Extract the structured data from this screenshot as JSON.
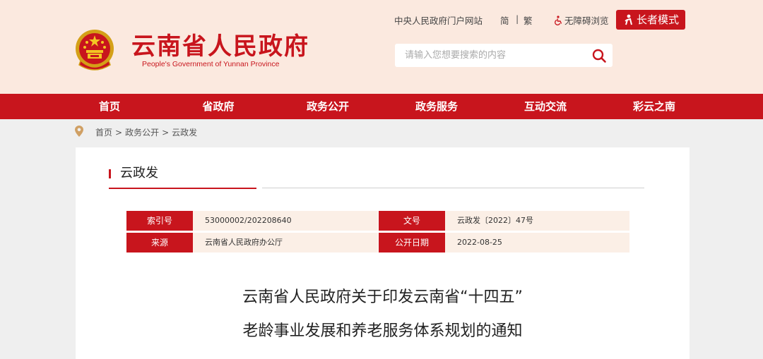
{
  "header": {
    "site_title": "云南省人民政府",
    "site_subtitle": "People's Government of Yunnan Province",
    "top_links": {
      "portal": "中央人民政府门户网站",
      "simplified": "简",
      "separator": "|",
      "traditional": "繁",
      "accessibility": "无障碍浏览"
    },
    "elder_mode_label": "长者模式",
    "search": {
      "placeholder": "请输入您想要搜索的内容",
      "value": ""
    }
  },
  "nav": {
    "items": [
      {
        "label": "首页"
      },
      {
        "label": "省政府"
      },
      {
        "label": "政务公开"
      },
      {
        "label": "政务服务"
      },
      {
        "label": "互动交流"
      },
      {
        "label": "彩云之南"
      }
    ]
  },
  "breadcrumb": {
    "items": [
      "首页",
      "政务公开",
      "云政发"
    ],
    "separator": ">"
  },
  "section": {
    "title": "云政发"
  },
  "meta": {
    "index_label": "索引号",
    "index_value": "53000002/202208640",
    "doc_no_label": "文号",
    "doc_no_value": "云政发〔2022〕47号",
    "source_label": "来源",
    "source_value": "云南省人民政府办公厅",
    "date_label": "公开日期",
    "date_value": "2022-08-25"
  },
  "document": {
    "title_line1": "云南省人民政府关于印发云南省“十四五”",
    "title_line2": "老龄事业发展和养老服务体系规划的通知"
  },
  "colors": {
    "brand_red": "#c8151d",
    "header_bg": "#fbe9df",
    "page_bg": "#efefef",
    "meta_value_bg": "#fbefe6"
  }
}
